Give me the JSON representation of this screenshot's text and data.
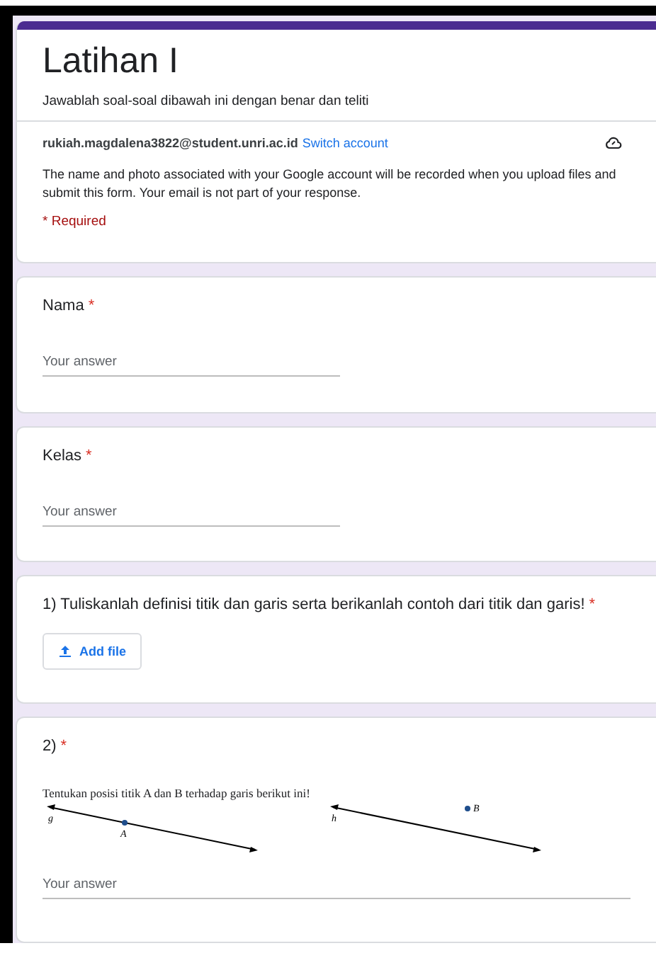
{
  "header": {
    "title": "Latihan I",
    "description": "Jawablah soal-soal dibawah ini dengan benar dan teliti",
    "email": "rukiah.magdalena3822@student.unri.ac.id",
    "switch_link": "Switch account",
    "notice": "The name and photo associated with your Google account will be recorded when you upload files and submit this form. Your email is not part of your response.",
    "required_note": "* Required"
  },
  "questions": [
    {
      "kind": "text",
      "title": "Nama",
      "required": true,
      "required_mark": "*",
      "placeholder": "Your answer"
    },
    {
      "kind": "text",
      "title": "Kelas",
      "required": true,
      "required_mark": "*",
      "placeholder": "Your answer"
    },
    {
      "kind": "file",
      "title": "1) Tuliskanlah definisi titik dan garis serta berikanlah contoh dari titik dan garis!",
      "required": true,
      "required_mark": "*",
      "button": "Add file"
    },
    {
      "kind": "image_text",
      "title": "2)",
      "required": true,
      "required_mark": "*",
      "image": {
        "caption": "Tentukan posisi titik A dan B terhadap garis berikut ini!",
        "line_1_label": "g",
        "point_1_label": "A",
        "line_2_label": "h",
        "point_2_label": "B"
      },
      "placeholder": "Your answer"
    }
  ]
}
